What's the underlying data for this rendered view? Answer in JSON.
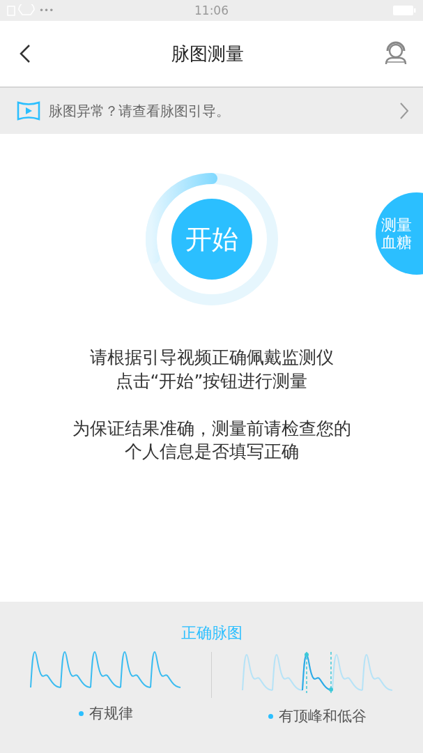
{
  "status_bar": {
    "time": "11:06",
    "dots": "•••"
  },
  "header": {
    "title": "脉图测量"
  },
  "banner": {
    "text": "脉图异常？请查看脉图引导。"
  },
  "start": {
    "label": "开始",
    "level": 0.3
  },
  "side_button": {
    "label": "测量血糖"
  },
  "instructions": [
    [
      "请根据引导视频正确佩戴监测仪",
      "点击“开始”按钮进行测量"
    ],
    [
      "为保证结果准确，测量前请检查您的",
      "个人信息是否填写正确"
    ]
  ],
  "guide": {
    "title": "正确脉图",
    "examples": [
      {
        "kind": "regular",
        "label": "有规律"
      },
      {
        "kind": "peak_valley",
        "label": "有顶峰和低谷"
      }
    ]
  }
}
